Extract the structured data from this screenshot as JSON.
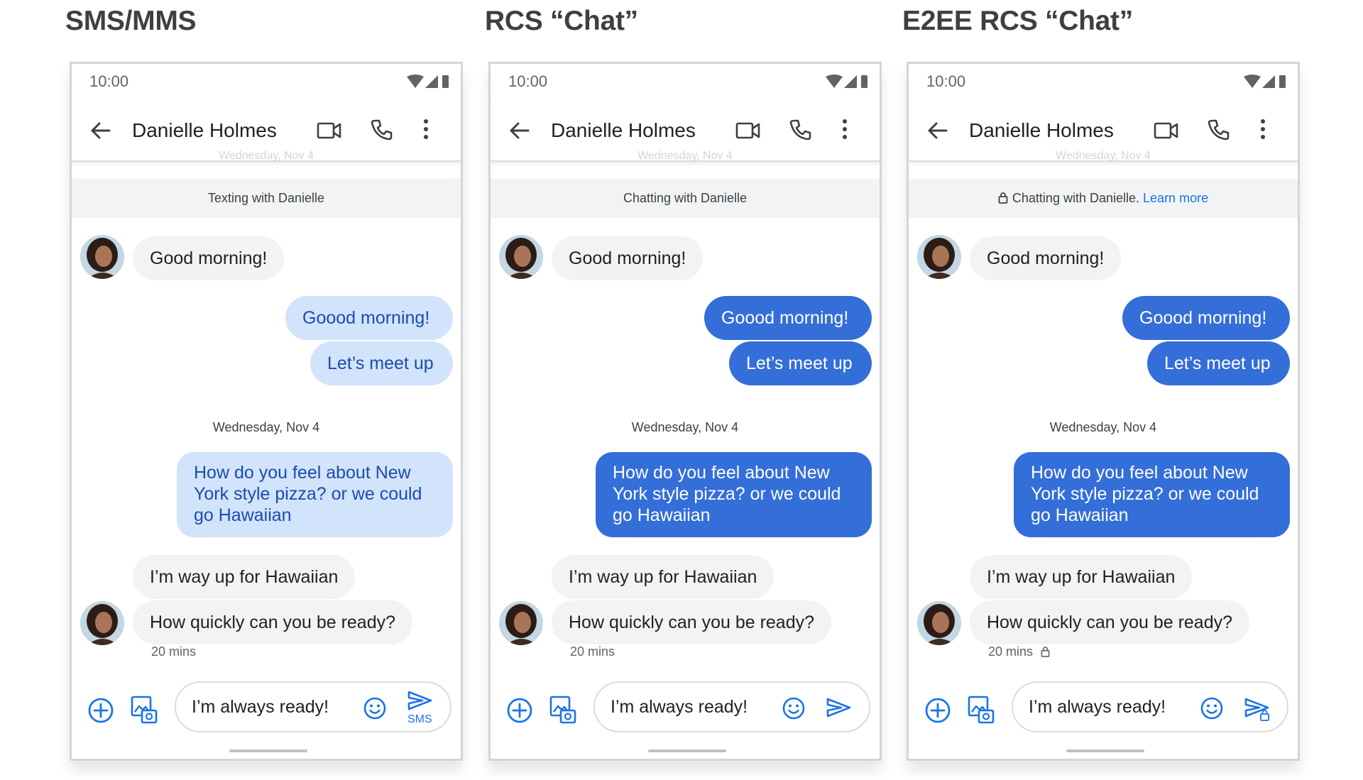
{
  "colors": {
    "accent": "#1a73e8",
    "sms_bubble": "#d2e3fc",
    "sms_text": "#1a4dad",
    "rcs_bubble": "#346ed9",
    "incoming_bubble": "#f1f3f4",
    "banner_bg": "#f1f3f4"
  },
  "panels": [
    {
      "title": "SMS/MMS",
      "phone": {
        "status_time": "10:00",
        "contact_name": "Danielle Holmes",
        "faded_date": "Wednesday, Nov 4",
        "banner": {
          "text": "Texting with Danielle",
          "link": ""
        },
        "messages": {
          "in1": "Good morning!",
          "out1": "Goood morning!",
          "out2": "Let’s meet up",
          "date_separator": "Wednesday, Nov 4",
          "out3_line1": "How do you feel about New",
          "out3_line2": "York style pizza? or we could",
          "out3_line3": "go Hawaiian",
          "in2": "I’m way up for Hawaiian",
          "in3": "How quickly can you be ready?",
          "time": "20 mins"
        },
        "compose_text": "I’m always ready!",
        "send_label": "SMS"
      }
    },
    {
      "title": "RCS “Chat”",
      "phone": {
        "status_time": "10:00",
        "contact_name": "Danielle Holmes",
        "faded_date": "Wednesday, Nov 4",
        "banner": {
          "text": "Chatting with Danielle",
          "link": ""
        },
        "messages": {
          "in1": "Good morning!",
          "out1": "Goood morning!",
          "out2": "Let’s meet up",
          "date_separator": "Wednesday, Nov 4",
          "out3_line1": "How do you feel about New",
          "out3_line2": "York style pizza? or we could",
          "out3_line3": "go Hawaiian",
          "in2": "I’m way up for Hawaiian",
          "in3": "How quickly can you be ready?",
          "time": "20 mins"
        },
        "compose_text": "I’m always ready!",
        "send_label": ""
      }
    },
    {
      "title": "E2EE RCS “Chat”",
      "phone": {
        "status_time": "10:00",
        "contact_name": "Danielle Holmes",
        "faded_date": "Wednesday, Nov 4",
        "banner": {
          "text": "Chatting with Danielle.",
          "link": "Learn more"
        },
        "messages": {
          "in1": "Good morning!",
          "out1": "Goood morning!",
          "out2": "Let’s meet up",
          "date_separator": "Wednesday, Nov 4",
          "out3_line1": "How do you feel about New",
          "out3_line2": "York style pizza? or we could",
          "out3_line3": "go Hawaiian",
          "in2": "I’m way up for Hawaiian",
          "in3": "How quickly can you be ready?",
          "time": "20 mins"
        },
        "compose_text": "I’m always ready!",
        "send_label": ""
      }
    }
  ],
  "icons": [
    "wifi-icon",
    "cellular-signal-icon",
    "battery-icon",
    "back-arrow-icon",
    "video-call-icon",
    "phone-call-icon",
    "more-vert-icon",
    "lock-icon",
    "add-circle-icon",
    "gallery-icon",
    "emoji-icon",
    "send-icon"
  ]
}
